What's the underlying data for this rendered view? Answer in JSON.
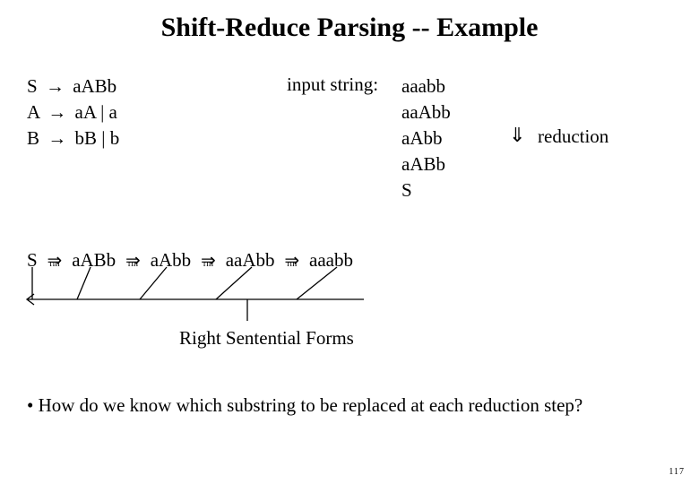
{
  "title": "Shift-Reduce Parsing -- Example",
  "grammar": {
    "line1_left": "S",
    "line1_right": "aABb",
    "line2_left": "A",
    "line2_right": "aA  |  a",
    "line3_left": "B",
    "line3_right": "bB  | b"
  },
  "production_arrow": "→",
  "input_label": "input string:",
  "reductions": {
    "r1": "aaabb",
    "r2": "aaAbb",
    "r3": "aAbb",
    "r4": "aABb",
    "r5": "S"
  },
  "downarrow": "⇓",
  "reduction_label": "reduction",
  "derivation": {
    "t1": "S",
    "t2": "aABb",
    "t3": "aAbb",
    "t4": "aaAbb",
    "t5": "aaabb"
  },
  "rm_arrow_glyph": "⇒",
  "rm_sub": "rm",
  "rsf_label": "Right Sentential Forms",
  "bullet": "•  How do we know which substring to be replaced at each reduction step?",
  "pagenum": "117"
}
